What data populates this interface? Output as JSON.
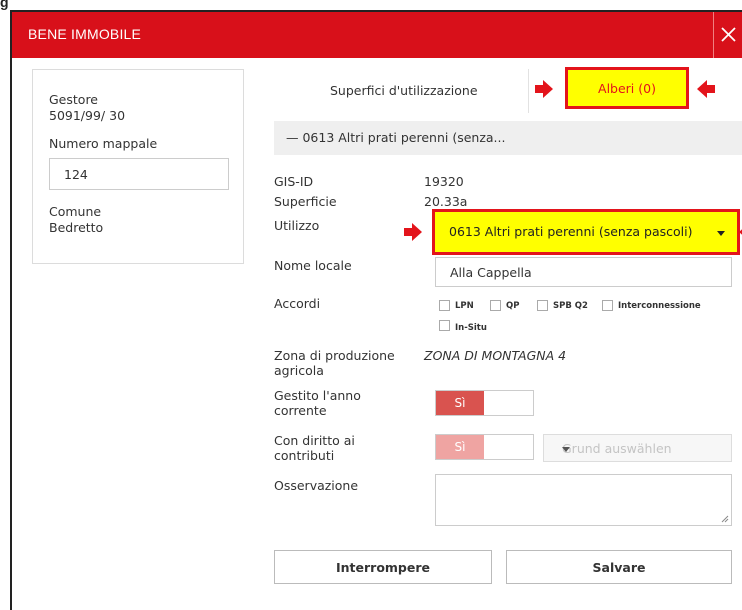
{
  "page_heading": "g",
  "dialog": {
    "title": "BENE IMMOBILE",
    "close_icon": "close-icon"
  },
  "left_panel": {
    "gestore_label": "Gestore",
    "gestore_value": "5091/99/ 30",
    "mappale_label": "Numero mappale",
    "mappale_value": "124",
    "comune_label": "Comune",
    "comune_value": "Bedretto"
  },
  "tabs": {
    "superfici": "Superfici d'utilizzazione",
    "alberi": "Alberi (0)"
  },
  "section": {
    "header": "— 0613 Altri prati perenni (senza..."
  },
  "fields": {
    "gis_label": "GIS-ID",
    "gis_value": "19320",
    "superficie_label": "Superficie",
    "superficie_value": "20.33a",
    "utilizzo_label": "Utilizzo",
    "utilizzo_value": "0613 Altri prati perenni (senza pascoli)",
    "nome_label": "Nome locale",
    "nome_value": "Alla Cappella",
    "accordi_label": "Accordi",
    "accordi_options": [
      "LPN",
      "QP",
      "SPB Q2",
      "Interconnessione",
      "In-Situ"
    ],
    "zona_label_1": "Zona di produzione",
    "zona_label_2": "agricola",
    "zona_value": "ZONA DI MONTAGNA 4",
    "gestito_label_1": "Gestito l'anno",
    "gestito_label_2": "corrente",
    "gestito_value": "Sì",
    "diritto_label_1": "Con diritto ai",
    "diritto_label_2": "contributi",
    "diritto_value": "Sì",
    "grund_placeholder": "Grund auswählen",
    "osservazione_label": "Osservazione",
    "osservazione_value": ""
  },
  "buttons": {
    "interrompere": "Interrompere",
    "salvare": "Salvare"
  },
  "colors": {
    "titlebar": "#d8101a",
    "highlight_fill": "#ffff00",
    "highlight_border": "#e3141b",
    "toggle_on": "#d9534f"
  }
}
